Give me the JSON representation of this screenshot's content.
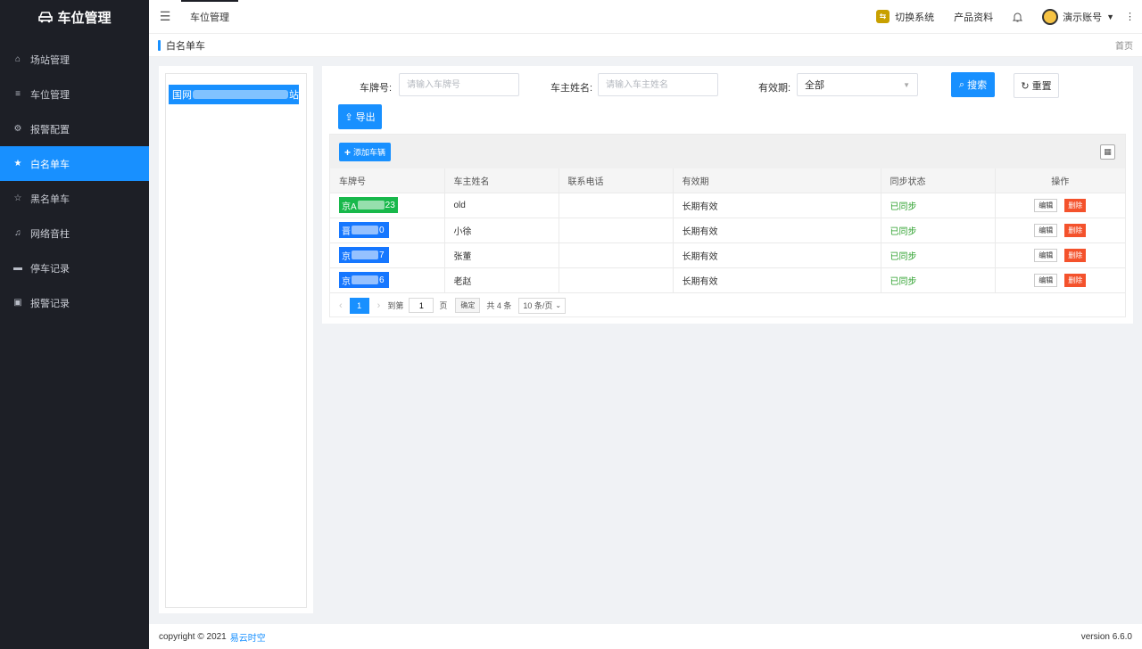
{
  "app": {
    "title": "车位管理"
  },
  "sidebar": {
    "items": [
      {
        "label": "场站管理",
        "icon": "home-icon",
        "active": false
      },
      {
        "label": "车位管理",
        "icon": "sliders-icon",
        "active": false
      },
      {
        "label": "报警配置",
        "icon": "gear-icon",
        "active": false
      },
      {
        "label": "白名单车",
        "icon": "star-filled-icon",
        "active": true
      },
      {
        "label": "黑名单车",
        "icon": "star-outline-icon",
        "active": false
      },
      {
        "label": "网络音柱",
        "icon": "bell-icon",
        "active": false
      },
      {
        "label": "停车记录",
        "icon": "car-icon",
        "active": false
      },
      {
        "label": "报警记录",
        "icon": "alarm-icon",
        "active": false
      }
    ]
  },
  "header": {
    "tab_label": "车位管理",
    "switch_system": "切换系统",
    "product_docs": "产品资料",
    "account": "演示账号"
  },
  "breadcrumb": {
    "current": "白名单车",
    "home": "首页"
  },
  "tree": {
    "node_prefix": "国网",
    "node_suffix": "站"
  },
  "filters": {
    "plate_label": "车牌号:",
    "plate_placeholder": "请输入车牌号",
    "owner_label": "车主姓名:",
    "owner_placeholder": "请输入车主姓名",
    "validity_label": "有效期:",
    "validity_value": "全部",
    "search_button": "搜索",
    "reset_button": "重置",
    "export_button": "导出"
  },
  "table": {
    "add_button": "添加车辆",
    "columns": [
      "车牌号",
      "车主姓名",
      "联系电话",
      "有效期",
      "同步状态",
      "操作"
    ],
    "rows": [
      {
        "plate_start": "京A",
        "plate_end": "23",
        "plate_color": "green",
        "owner": "old",
        "phone": "",
        "validity": "长期有效",
        "sync": "已同步"
      },
      {
        "plate_start": "晋",
        "plate_end": "0",
        "plate_color": "blue",
        "owner": "小徐",
        "phone": "",
        "validity": "长期有效",
        "sync": "已同步"
      },
      {
        "plate_start": "京",
        "plate_end": "7",
        "plate_color": "blue",
        "owner": "张董",
        "phone": "",
        "validity": "长期有效",
        "sync": "已同步"
      },
      {
        "plate_start": "京",
        "plate_end": "6",
        "plate_color": "blue",
        "owner": "老赵",
        "phone": "",
        "validity": "长期有效",
        "sync": "已同步"
      }
    ],
    "edit_label": "编辑",
    "delete_label": "删除"
  },
  "pagination": {
    "current_page": "1",
    "goto_label": "到第",
    "goto_value": "1",
    "page_unit": "页",
    "confirm": "确定",
    "total": "共 4 条",
    "page_size": "10 条/页"
  },
  "footer": {
    "copyright": "copyright © 2021",
    "brand": "易云时空",
    "version": "version 6.6.0"
  },
  "colors": {
    "primary": "#1890ff",
    "sidebar_bg": "#1d1f26",
    "success": "#2ea12e",
    "danger": "#f4522c",
    "plate_green": "#18b84b"
  }
}
